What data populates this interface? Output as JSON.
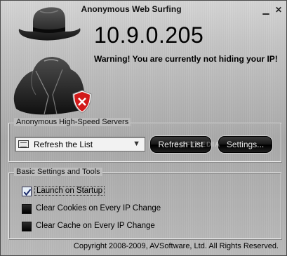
{
  "window": {
    "title": "Anonymous Web Surfing",
    "minimize_symbol": "▁",
    "close_symbol": "✕"
  },
  "status": {
    "ip_address": "10.9.0.205",
    "warning": "Warning! You are currently not hiding your IP!"
  },
  "icons": {
    "hat": "fedora-hat-icon",
    "coat": "trench-coat-icon",
    "shield": "shield-error-icon"
  },
  "servers": {
    "group_label": "Anonymous High-Speed Servers",
    "selected_value": "Refresh the List",
    "refresh_label": "Refresh List",
    "settings_label": "Settings..."
  },
  "basic_settings": {
    "group_label": "Basic Settings and Tools",
    "options": [
      {
        "label": "Launch on Startup",
        "checked": true
      },
      {
        "label": "Clear Cookies on Every IP Change",
        "checked": false
      },
      {
        "label": "Clear Cache on Every IP Change",
        "checked": false
      }
    ]
  },
  "footer": {
    "copyright": "Copyright 2008-2009, AVSoftware, Ltd. All Rights Reserved."
  },
  "colors": {
    "window_bg": "#bdbdbd",
    "button_bg": "#111111",
    "shield_red": "#d21a1a"
  }
}
